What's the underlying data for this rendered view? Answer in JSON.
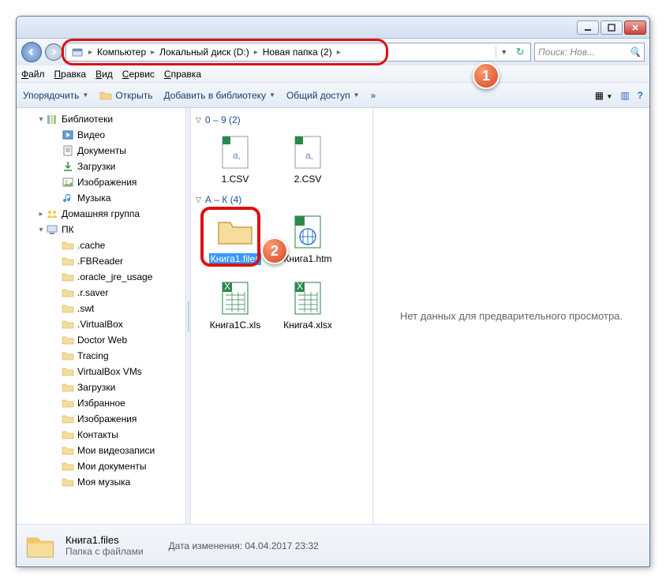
{
  "titlebar": {
    "min": "_",
    "max": "▢",
    "close": "✕"
  },
  "breadcrumbs": [
    "Компьютер",
    "Локальный диск (D:)",
    "Новая папка (2)"
  ],
  "search": {
    "placeholder": "Поиск: Нов..."
  },
  "menu": [
    "Файл",
    "Правка",
    "Вид",
    "Сервис",
    "Справка"
  ],
  "toolbar": {
    "organize": "Упорядочить",
    "open": "Открыть",
    "library": "Добавить в библиотеку",
    "share": "Общий доступ",
    "burn": "»"
  },
  "tree": [
    {
      "ind": 25,
      "icon": "lib",
      "label": "Библиотеки",
      "tw": "▾"
    },
    {
      "ind": 45,
      "icon": "vid",
      "label": "Видео"
    },
    {
      "ind": 45,
      "icon": "doc",
      "label": "Документы"
    },
    {
      "ind": 45,
      "icon": "dl",
      "label": "Загрузки"
    },
    {
      "ind": 45,
      "icon": "img",
      "label": "Изображения"
    },
    {
      "ind": 45,
      "icon": "mus",
      "label": "Музыка"
    },
    {
      "ind": 25,
      "icon": "hg",
      "label": "Домашняя группа",
      "tw": "▸"
    },
    {
      "ind": 25,
      "icon": "pc",
      "label": "ПК",
      "tw": "▾"
    },
    {
      "ind": 45,
      "icon": "fld",
      "label": ".cache"
    },
    {
      "ind": 45,
      "icon": "fld",
      "label": ".FBReader"
    },
    {
      "ind": 45,
      "icon": "fld",
      "label": ".oracle_jre_usage"
    },
    {
      "ind": 45,
      "icon": "fld",
      "label": ".r.saver"
    },
    {
      "ind": 45,
      "icon": "fld",
      "label": ".swt"
    },
    {
      "ind": 45,
      "icon": "fld",
      "label": ".VirtualBox"
    },
    {
      "ind": 45,
      "icon": "fld",
      "label": "Doctor Web"
    },
    {
      "ind": 45,
      "icon": "fld",
      "label": "Tracing"
    },
    {
      "ind": 45,
      "icon": "fld",
      "label": "VirtualBox VMs"
    },
    {
      "ind": 45,
      "icon": "fld",
      "label": "Загрузки"
    },
    {
      "ind": 45,
      "icon": "fld",
      "label": "Избранное"
    },
    {
      "ind": 45,
      "icon": "fld",
      "label": "Изображения"
    },
    {
      "ind": 45,
      "icon": "fld",
      "label": "Контакты"
    },
    {
      "ind": 45,
      "icon": "fld",
      "label": "Мои видеозаписи"
    },
    {
      "ind": 45,
      "icon": "fld",
      "label": "Мои документы"
    },
    {
      "ind": 45,
      "icon": "fld",
      "label": "Моя музыка"
    }
  ],
  "groups": [
    {
      "title": "0 – 9 (2)",
      "items": [
        {
          "icon": "csv",
          "label": "1.CSV"
        },
        {
          "icon": "csv",
          "label": "2.CSV"
        }
      ]
    },
    {
      "title": "А – К (4)",
      "items": [
        {
          "icon": "folder",
          "label": "Книга1.files",
          "sel": true,
          "hl": true
        },
        {
          "icon": "htm",
          "label": "Книга1.htm"
        },
        {
          "icon": "xls",
          "label": "Книга1C.xls"
        },
        {
          "icon": "xlsx",
          "label": "Книга4.xlsx"
        }
      ]
    }
  ],
  "preview": "Нет данных для предварительного просмотра.",
  "status": {
    "name": "Книга1.files",
    "type": "Папка с файлами",
    "modlabel": "Дата изменения:",
    "mod": "04.04.2017 23:32"
  },
  "callouts": {
    "1": "1",
    "2": "2"
  }
}
